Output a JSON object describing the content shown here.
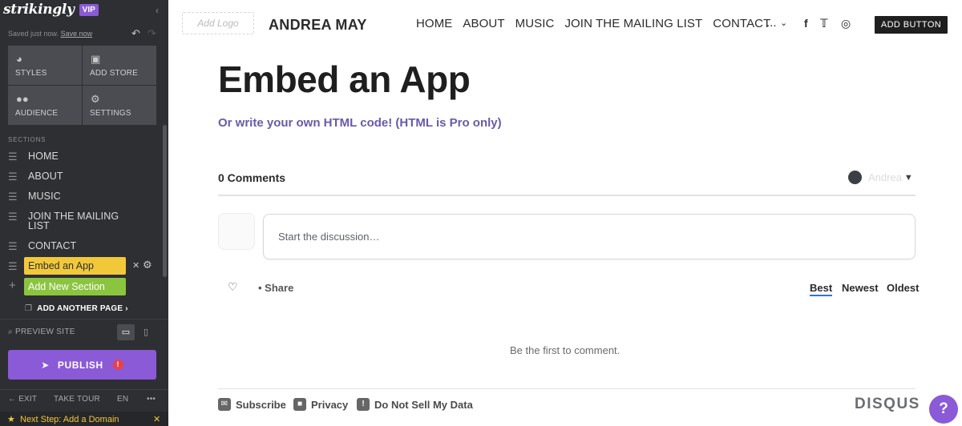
{
  "editor": {
    "brand": "strikingly",
    "badge": "VIP",
    "collapse_icon": "chevron-left-icon",
    "saved_text": "Saved just now.",
    "save_link": "Save now",
    "tiles": [
      {
        "label": "STYLES",
        "icon": "palette-icon"
      },
      {
        "label": "ADD STORE",
        "icon": "store-icon"
      },
      {
        "label": "AUDIENCE",
        "icon": "users-icon"
      },
      {
        "label": "SETTINGS",
        "icon": "gear-icon"
      }
    ],
    "sections_header": "SECTIONS",
    "sections": [
      "HOME",
      "ABOUT",
      "MUSIC",
      "JOIN THE MAILING\nLIST",
      "CONTACT"
    ],
    "selected_section": "Embed an App",
    "add_section": "Add New Section",
    "add_page": "ADD ANOTHER PAGE",
    "preview": "PREVIEW SITE",
    "publish": "PUBLISH",
    "publish_warning": "!",
    "exit": "EXIT",
    "tour": "TAKE TOUR",
    "lang": "EN",
    "more": "•••",
    "next_step": "Next Step: Add a Domain"
  },
  "site": {
    "add_logo": "Add Logo",
    "title": "ANDREA MAY",
    "nav": [
      "HOME",
      "ABOUT",
      "MUSIC",
      "JOIN THE MAILING LIST",
      "CONTACT"
    ],
    "nav_more": "...",
    "social_icons": [
      "facebook-icon",
      "twitter-icon",
      "instagram-icon"
    ],
    "add_button": "ADD BUTTON"
  },
  "content": {
    "heading": "Embed an App",
    "subheading": "Or write your own HTML code! (HTML is Pro only)"
  },
  "comments": {
    "count_label": "0 Comments",
    "user_name": "Andrea",
    "placeholder": "Start the discussion…",
    "share": "Share",
    "sort": [
      "Best",
      "Newest",
      "Oldest"
    ],
    "active_sort": "Best",
    "empty_text": "Be the first to comment.",
    "footer": [
      "Subscribe",
      "Privacy",
      "Do Not Sell My Data"
    ],
    "brand": "DISQUS"
  },
  "help_label": "?",
  "colors": {
    "sidebar_bg": "#2e2f33",
    "accent_purple": "#8a5ad7",
    "selected_yellow": "#f2c83b",
    "add_green": "#8bc43f",
    "subheading_purple": "#6a5aa8",
    "sort_underline": "#2e73d8"
  }
}
